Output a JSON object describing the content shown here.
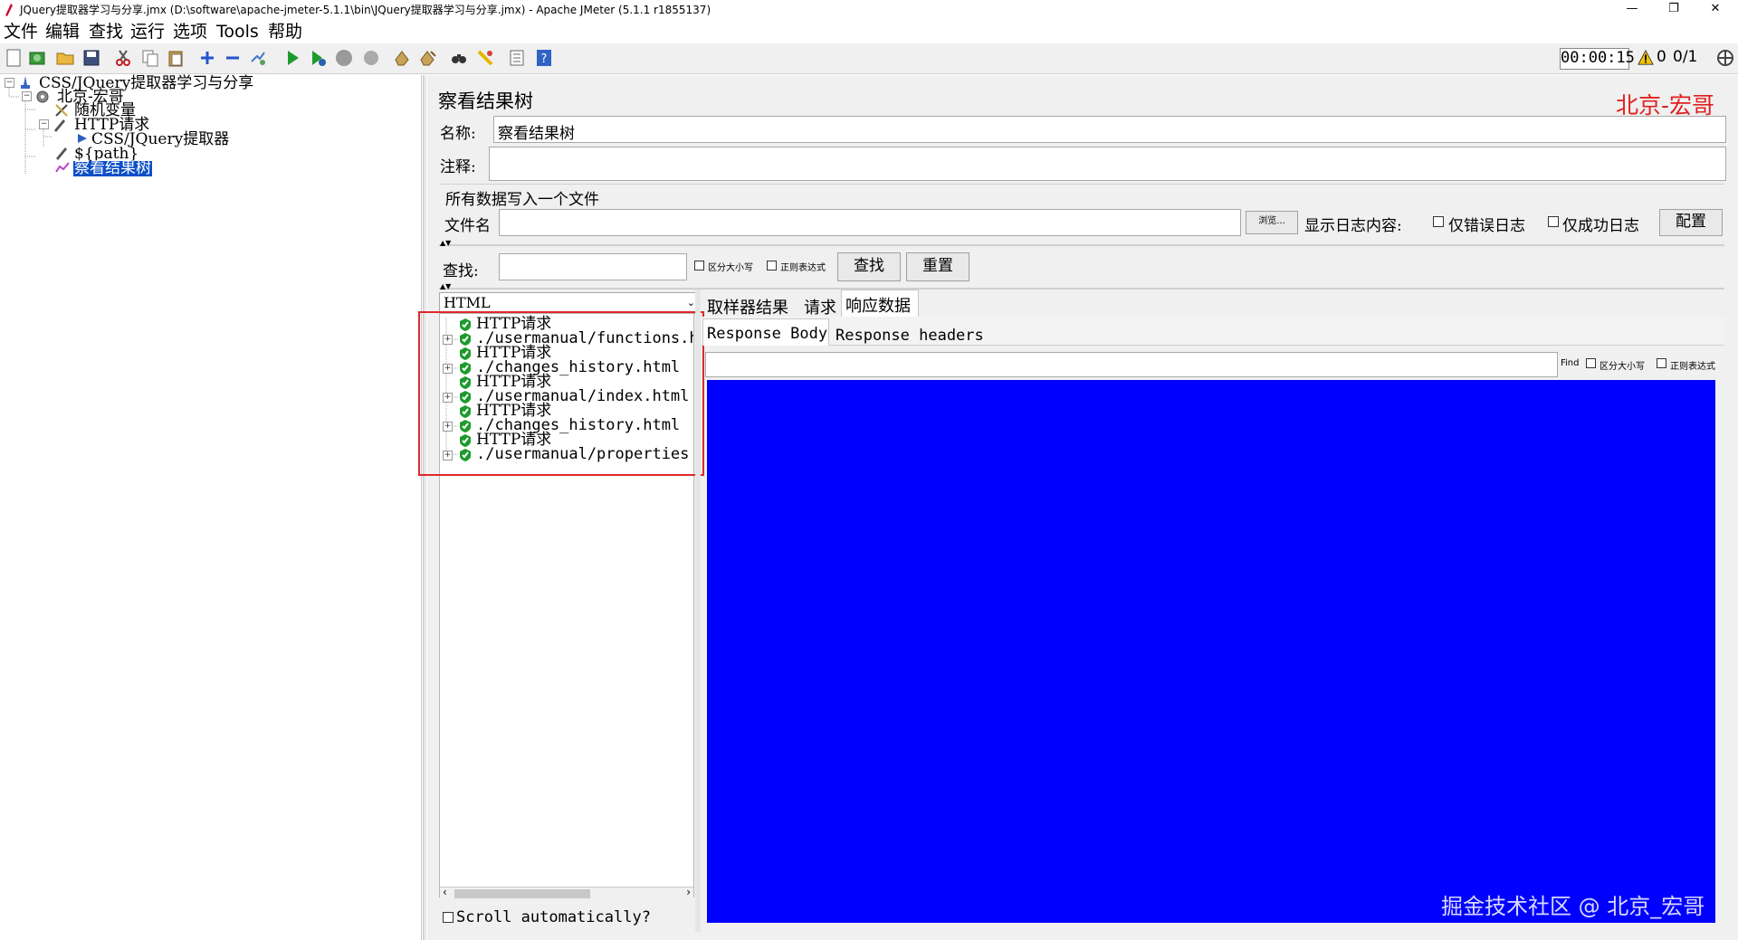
{
  "window": {
    "title": "JQuery提取器学习与分享.jmx (D:\\software\\apache-jmeter-5.1.1\\bin\\JQuery提取器学习与分享.jmx) - Apache JMeter (5.1.1 r1855137)",
    "minimize": "—",
    "restore": "❐",
    "close": "✕"
  },
  "menu": [
    "文件",
    "编辑",
    "查找",
    "运行",
    "选项",
    "Tools",
    "帮助"
  ],
  "status": {
    "timer": "00:00:15",
    "warnings": "0",
    "threads": "0/1"
  },
  "tree": {
    "root": "CSS/JQuery提取器学习与分享",
    "thread_group": "北京-宏哥",
    "random_var": "随机变量",
    "http_request": "HTTP请求",
    "extractor": "CSS/JQuery提取器",
    "path": "${path}",
    "listener": "察看结果树"
  },
  "panel": {
    "title": "察看结果树",
    "brand": "北京-宏哥",
    "name_label": "名称:",
    "name_value": "察看结果树",
    "comment_label": "注释:",
    "comment_value": "",
    "write_all_label": "所有数据写入一个文件",
    "filename_label": "文件名",
    "filename_value": "",
    "browse_label": "浏览...",
    "log_content_label": "显示日志内容:",
    "errors_only_label": "仅错误日志",
    "success_only_label": "仅成功日志",
    "configure_label": "配置",
    "search_label": "查找:",
    "search_value": "",
    "case_sensitive_label": "区分大小写",
    "regex_label": "正则表达式",
    "find_button": "查找",
    "reset_button": "重置"
  },
  "renderer": {
    "selected": "HTML"
  },
  "results": [
    {
      "name": "HTTP请求",
      "url": "./usermanual/functions.h"
    },
    {
      "name": "HTTP请求",
      "url": "./changes_history.html"
    },
    {
      "name": "HTTP请求",
      "url": "./usermanual/index.html"
    },
    {
      "name": "HTTP请求",
      "url": "./changes_history.html"
    },
    {
      "name": "HTTP请求",
      "url": "./usermanual/properties"
    }
  ],
  "scroll_auto_label": "Scroll automatically?",
  "tabs": {
    "sampler_result": "取样器结果",
    "request": "请求",
    "response_data": "响应数据"
  },
  "subtabs": {
    "body": "Response Body",
    "headers": "Response headers"
  },
  "inner_find": {
    "label": "Find",
    "value": "",
    "case_label": "区分大小写",
    "regex_label": "正则表达式"
  },
  "watermark": "掘金技术社区 @ 北京_宏哥",
  "colors": {
    "response_area": "#0000ff",
    "highlight_box": "#e0282a",
    "brand": "#e02020",
    "selection": "#0a4fc6"
  }
}
